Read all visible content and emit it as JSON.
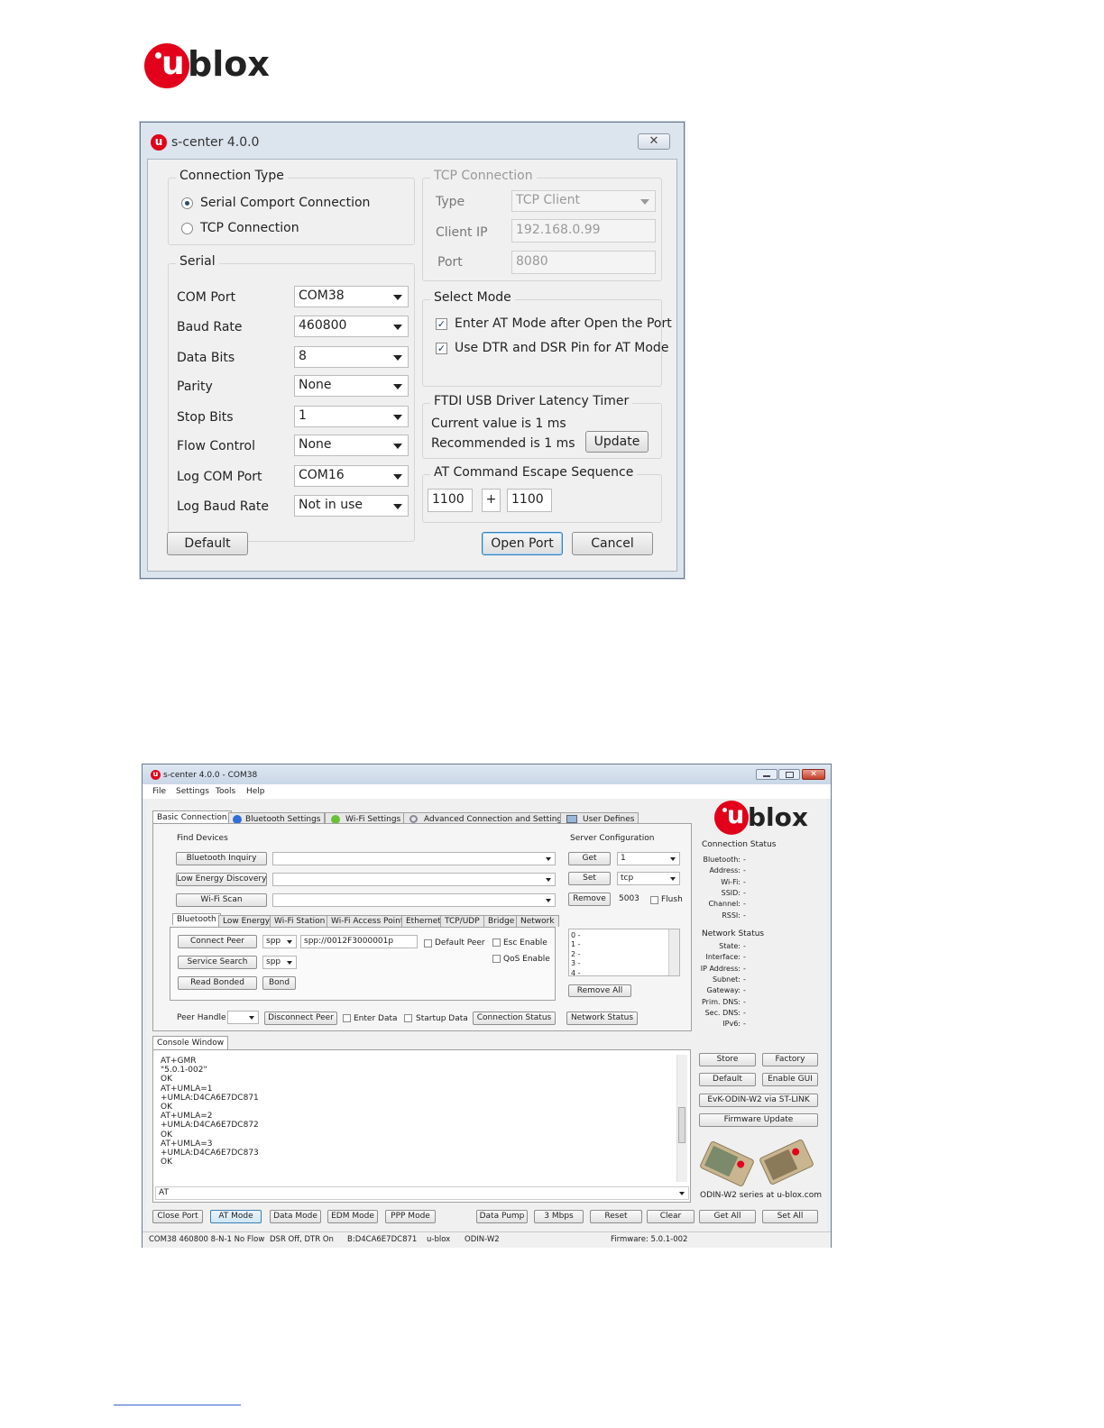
{
  "logo_text": "blox",
  "dialog": {
    "title": "s-center 4.0.0",
    "connection_type": {
      "title": "Connection Type",
      "serial": "Serial Comport Connection",
      "tcp": "TCP Connection",
      "selected": "serial"
    },
    "serial": {
      "title": "Serial",
      "fields": [
        {
          "label": "COM Port",
          "value": "COM38"
        },
        {
          "label": "Baud Rate",
          "value": "460800"
        },
        {
          "label": "Data Bits",
          "value": "8"
        },
        {
          "label": "Parity",
          "value": "None"
        },
        {
          "label": "Stop Bits",
          "value": "1"
        },
        {
          "label": "Flow Control",
          "value": "None"
        },
        {
          "label": "Log COM Port",
          "value": "COM16"
        },
        {
          "label": "Log Baud Rate",
          "value": "Not in use"
        }
      ]
    },
    "tcp_connection": {
      "title": "TCP Connection",
      "type_label": "Type",
      "type_value": "TCP Client",
      "client_ip_label": "Client IP",
      "client_ip_value": "192.168.0.99",
      "port_label": "Port",
      "port_value": "8080"
    },
    "select_mode": {
      "title": "Select Mode",
      "opt1": "Enter AT Mode after Open the Port",
      "opt2": "Use DTR and DSR Pin for AT Mode",
      "check_mark": "✓"
    },
    "ftdi": {
      "title": "FTDI USB Driver Latency Timer",
      "current": "Current value is 1 ms",
      "recommended": "Recommended is 1 ms",
      "update": "Update"
    },
    "escape": {
      "title": "AT Command Escape Sequence",
      "value1": "1100",
      "plus": "+",
      "value2": "1100"
    },
    "buttons": {
      "default": "Default",
      "open": "Open Port",
      "cancel": "Cancel"
    }
  },
  "window2": {
    "title": "s-center 4.0.0 - COM38",
    "menu": [
      "File",
      "Settings",
      "Tools",
      "Help"
    ],
    "tabs": [
      "Basic Connection",
      "Bluetooth Settings",
      "Wi-Fi Settings",
      "Advanced Connection and Settings",
      "User Defines"
    ],
    "find_devices": {
      "title": "Find Devices",
      "buttons": [
        "Bluetooth Inquiry",
        "Low Energy Discovery",
        "Wi-Fi Scan"
      ]
    },
    "sub_tabs": [
      "Bluetooth",
      "Low Energy",
      "Wi-Fi Station",
      "Wi-Fi Access Point",
      "Ethernet",
      "TCP/UDP",
      "Bridge",
      "Network"
    ],
    "bt": {
      "connect_peer": "Connect Peer",
      "service_search": "Service Search",
      "read_bonded": "Read Bonded",
      "bond": "Bond",
      "spp1": "spp",
      "spp2": "spp",
      "peer_url": "spp://0012F3000001p",
      "default_peer": "Default Peer",
      "esc_enable": "Esc Enable",
      "qos_enable": "QoS Enable"
    },
    "peer_row": {
      "peer_handle": "Peer Handle",
      "disconnect": "Disconnect Peer",
      "enter_data": "Enter Data",
      "startup_data": "Startup Data",
      "connection_status": "Connection Status",
      "network_status": "Network Status"
    },
    "server": {
      "title": "Server Configuration",
      "get": "Get",
      "get_value": "1",
      "set": "Set",
      "set_value": "tcp",
      "remove": "Remove",
      "remove_value": "5003",
      "flush": "Flush",
      "list": [
        "0 -",
        "1 -",
        "2 -",
        "3 -",
        "4 -"
      ],
      "remove_all": "Remove All"
    },
    "connection_status": {
      "title": "Connection Status",
      "rows": [
        {
          "label": "Bluetooth:",
          "value": "-"
        },
        {
          "label": "Address:",
          "value": "-"
        },
        {
          "label": "Wi-Fi:",
          "value": "-"
        },
        {
          "label": "SSID:",
          "value": "-"
        },
        {
          "label": "Channel:",
          "value": "-"
        },
        {
          "label": "RSSI:",
          "value": "-"
        }
      ]
    },
    "network_status": {
      "title": "Network Status",
      "rows": [
        {
          "label": "State:",
          "value": "-"
        },
        {
          "label": "Interface:",
          "value": "-"
        },
        {
          "label": "IP Address:",
          "value": "-"
        },
        {
          "label": "Subnet:",
          "value": "-"
        },
        {
          "label": "Gateway:",
          "value": "-"
        },
        {
          "label": "Prim. DNS:",
          "value": "-"
        },
        {
          "label": "Sec. DNS:",
          "value": "-"
        },
        {
          "label": "IPv6:",
          "value": "-"
        }
      ]
    },
    "console": {
      "tab": "Console Window",
      "text": "AT+GMR\n\"5.0.1-002\"\nOK\nAT+UMLA=1\n+UMLA:D4CA6E7DC871\nOK\nAT+UMLA=2\n+UMLA:D4CA6E7DC872\nOK\nAT+UMLA=3\n+UMLA:D4CA6E7DC873\nOK",
      "input": "AT"
    },
    "right_buttons": {
      "store": "Store",
      "factory": "Factory",
      "default": "Default",
      "enable_gui": "Enable GUI",
      "evk": "EvK-ODIN-W2 via ST-LINK",
      "firmware": "Firmware Update"
    },
    "product_caption": "ODIN-W2 series at u-blox.com",
    "bottom_buttons": [
      "Close Port",
      "AT Mode",
      "Data Mode",
      "EDM Mode",
      "PPP Mode",
      "Data Pump",
      "3 Mbps",
      "Reset",
      "Clear",
      "Get All",
      "Set All"
    ],
    "status_bar": [
      "COM38 460800 8-N-1 No Flow",
      "DSR Off, DTR On",
      "B:D4CA6E7DC871",
      "u-blox",
      "ODIN-W2",
      "Firmware: 5.0.1-002"
    ]
  }
}
